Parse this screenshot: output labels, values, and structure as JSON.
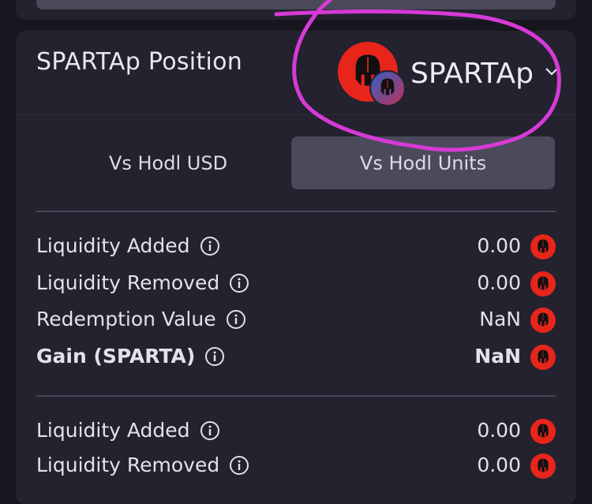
{
  "position_card": {
    "title": "SPARTAp Position",
    "pool_select": {
      "label": "SPARTAp",
      "icon": "spartan-helmet-icon",
      "sub_icon": "spartan-helmet-icon"
    }
  },
  "tabs": [
    {
      "label": "Vs Hodl USD",
      "active": false
    },
    {
      "label": "Vs Hodl Units",
      "active": true
    }
  ],
  "section1": {
    "rows": [
      {
        "label": "Liquidity Added",
        "value": "0.00",
        "bold": false
      },
      {
        "label": "Liquidity Removed",
        "value": "0.00",
        "bold": false
      },
      {
        "label": "Redemption Value",
        "value": "NaN",
        "bold": false
      },
      {
        "label": "Gain (SPARTA)",
        "value": "NaN",
        "bold": true
      }
    ]
  },
  "section2": {
    "rows": [
      {
        "label": "Liquidity Added",
        "value": "0.00"
      },
      {
        "label": "Liquidity Removed",
        "value": "0.00"
      }
    ]
  },
  "colors": {
    "background": "#17161f",
    "card": "#23222e",
    "active_tab": "#4b4a5b",
    "token_red": "#e8251b",
    "annotation_magenta": "#d63ad6"
  }
}
